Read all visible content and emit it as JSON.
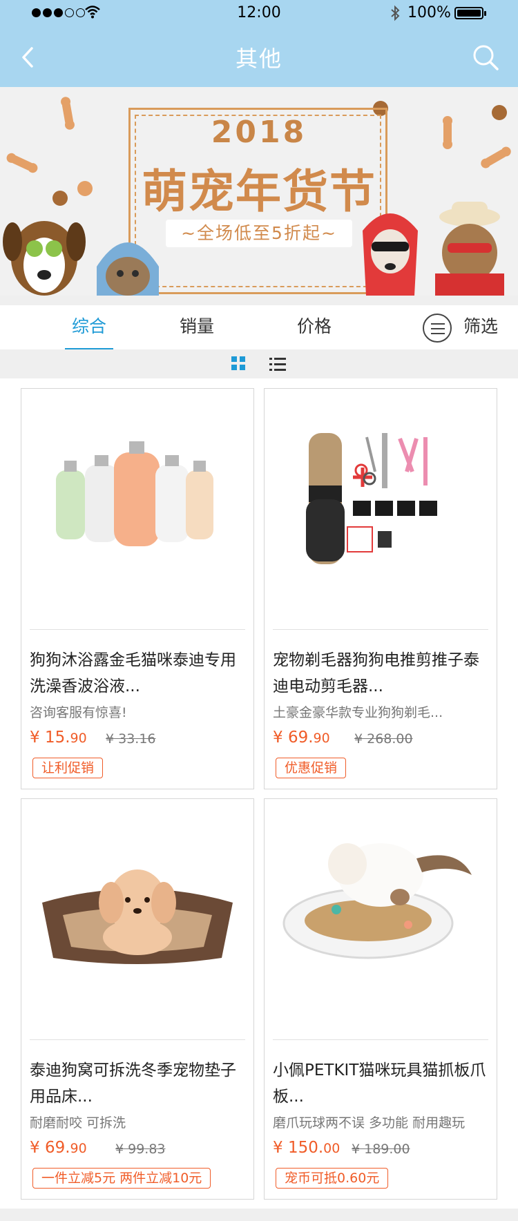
{
  "status_bar": {
    "time": "12:00",
    "battery": "100%"
  },
  "nav": {
    "title": "其他"
  },
  "banner": {
    "year": "2018",
    "headline": "萌宠年货节",
    "subtitle": "~全场低至5折起~"
  },
  "tabs": [
    {
      "label": "综合",
      "active": true
    },
    {
      "label": "销量",
      "active": false
    },
    {
      "label": "价格",
      "active": false
    }
  ],
  "filter": {
    "label": "筛选"
  },
  "products": [
    {
      "title": "狗狗沐浴露金毛猫咪泰迪专用洗澡香波浴液...",
      "desc": "咨询客服有惊喜!",
      "price_int": "¥ 15.",
      "price_frac": "90",
      "orig": "¥ 33.16",
      "tag": "让利促销"
    },
    {
      "title": "宠物剃毛器狗狗电推剪推子泰迪电动剪毛器...",
      "desc": "土豪金豪华款专业狗狗剃毛...",
      "price_int": "¥ 69.",
      "price_frac": "90",
      "orig": "¥ 268.00",
      "tag": "优惠促销"
    },
    {
      "title": "泰迪狗窝可拆洗冬季宠物垫子用品床...",
      "desc": "耐磨耐咬 可拆洗",
      "price_int": "¥ 69.",
      "price_frac": "90",
      "orig": "¥ 99.83",
      "tag": "一件立减5元 两件立减10元"
    },
    {
      "title": "小佩PETKIT猫咪玩具猫抓板爪板...",
      "desc": "磨爪玩球两不误 多功能 耐用趣玩",
      "price_int": "¥ 150.",
      "price_frac": "00",
      "orig": "¥ 189.00",
      "tag": "宠币可抵0.60元"
    }
  ],
  "colors": {
    "nav_bg": "#a8d6f0",
    "accent": "#1e9ad6",
    "price": "#f05c28"
  }
}
